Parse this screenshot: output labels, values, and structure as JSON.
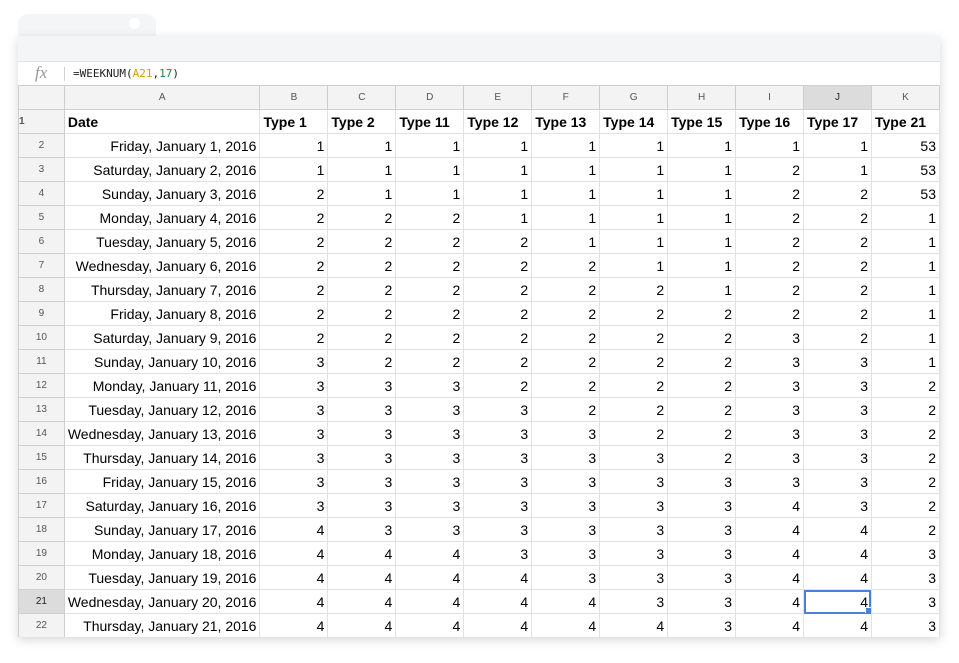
{
  "formula_bar": {
    "fx_label": "fx",
    "tokens": [
      {
        "t": "=WEEKNUM(",
        "c": "fn"
      },
      {
        "t": "A21",
        "c": "ref"
      },
      {
        "t": ",",
        "c": "fn"
      },
      {
        "t": "17",
        "c": "num"
      },
      {
        "t": ")",
        "c": "fn"
      }
    ]
  },
  "columns": [
    "A",
    "B",
    "C",
    "D",
    "E",
    "F",
    "G",
    "H",
    "I",
    "J",
    "K"
  ],
  "selected_column": "J",
  "selected_row": "21",
  "active_cell": {
    "row": 21,
    "col": "J"
  },
  "header_row": {
    "row_number": "1",
    "cells": [
      "Date",
      "Type 1",
      "Type 2",
      "Type 11",
      "Type 12",
      "Type 13",
      "Type 14",
      "Type 15",
      "Type 16",
      "Type 17",
      "Type 21"
    ]
  },
  "rows": [
    {
      "row_number": "2",
      "date": "Friday, January 1, 2016",
      "values": [
        "1",
        "1",
        "1",
        "1",
        "1",
        "1",
        "1",
        "1",
        "1",
        "53"
      ]
    },
    {
      "row_number": "3",
      "date": "Saturday, January 2, 2016",
      "values": [
        "1",
        "1",
        "1",
        "1",
        "1",
        "1",
        "1",
        "2",
        "1",
        "53"
      ]
    },
    {
      "row_number": "4",
      "date": "Sunday, January 3, 2016",
      "values": [
        "2",
        "1",
        "1",
        "1",
        "1",
        "1",
        "1",
        "2",
        "2",
        "53"
      ]
    },
    {
      "row_number": "5",
      "date": "Monday, January 4, 2016",
      "values": [
        "2",
        "2",
        "2",
        "1",
        "1",
        "1",
        "1",
        "2",
        "2",
        "1"
      ]
    },
    {
      "row_number": "6",
      "date": "Tuesday, January 5, 2016",
      "values": [
        "2",
        "2",
        "2",
        "2",
        "1",
        "1",
        "1",
        "2",
        "2",
        "1"
      ]
    },
    {
      "row_number": "7",
      "date": "Wednesday, January 6, 2016",
      "values": [
        "2",
        "2",
        "2",
        "2",
        "2",
        "1",
        "1",
        "2",
        "2",
        "1"
      ]
    },
    {
      "row_number": "8",
      "date": "Thursday, January 7, 2016",
      "values": [
        "2",
        "2",
        "2",
        "2",
        "2",
        "2",
        "1",
        "2",
        "2",
        "1"
      ]
    },
    {
      "row_number": "9",
      "date": "Friday, January 8, 2016",
      "values": [
        "2",
        "2",
        "2",
        "2",
        "2",
        "2",
        "2",
        "2",
        "2",
        "1"
      ]
    },
    {
      "row_number": "10",
      "date": "Saturday, January 9, 2016",
      "values": [
        "2",
        "2",
        "2",
        "2",
        "2",
        "2",
        "2",
        "3",
        "2",
        "1"
      ]
    },
    {
      "row_number": "11",
      "date": "Sunday, January 10, 2016",
      "values": [
        "3",
        "2",
        "2",
        "2",
        "2",
        "2",
        "2",
        "3",
        "3",
        "1"
      ]
    },
    {
      "row_number": "12",
      "date": "Monday, January 11, 2016",
      "values": [
        "3",
        "3",
        "3",
        "2",
        "2",
        "2",
        "2",
        "3",
        "3",
        "2"
      ]
    },
    {
      "row_number": "13",
      "date": "Tuesday, January 12, 2016",
      "values": [
        "3",
        "3",
        "3",
        "3",
        "2",
        "2",
        "2",
        "3",
        "3",
        "2"
      ]
    },
    {
      "row_number": "14",
      "date": "Wednesday, January 13, 2016",
      "values": [
        "3",
        "3",
        "3",
        "3",
        "3",
        "2",
        "2",
        "3",
        "3",
        "2"
      ]
    },
    {
      "row_number": "15",
      "date": "Thursday, January 14, 2016",
      "values": [
        "3",
        "3",
        "3",
        "3",
        "3",
        "3",
        "2",
        "3",
        "3",
        "2"
      ]
    },
    {
      "row_number": "16",
      "date": "Friday, January 15, 2016",
      "values": [
        "3",
        "3",
        "3",
        "3",
        "3",
        "3",
        "3",
        "3",
        "3",
        "2"
      ]
    },
    {
      "row_number": "17",
      "date": "Saturday, January 16, 2016",
      "values": [
        "3",
        "3",
        "3",
        "3",
        "3",
        "3",
        "3",
        "4",
        "3",
        "2"
      ]
    },
    {
      "row_number": "18",
      "date": "Sunday, January 17, 2016",
      "values": [
        "4",
        "3",
        "3",
        "3",
        "3",
        "3",
        "3",
        "4",
        "4",
        "2"
      ]
    },
    {
      "row_number": "19",
      "date": "Monday, January 18, 2016",
      "values": [
        "4",
        "4",
        "4",
        "3",
        "3",
        "3",
        "3",
        "4",
        "4",
        "3"
      ]
    },
    {
      "row_number": "20",
      "date": "Tuesday, January 19, 2016",
      "values": [
        "4",
        "4",
        "4",
        "4",
        "3",
        "3",
        "3",
        "4",
        "4",
        "3"
      ]
    },
    {
      "row_number": "21",
      "date": "Wednesday, January 20, 2016",
      "values": [
        "4",
        "4",
        "4",
        "4",
        "4",
        "3",
        "3",
        "4",
        "4",
        "3"
      ]
    },
    {
      "row_number": "22",
      "date": "Thursday, January 21, 2016",
      "values": [
        "4",
        "4",
        "4",
        "4",
        "4",
        "4",
        "3",
        "4",
        "4",
        "3"
      ]
    }
  ],
  "colors": {
    "selection": "#4a7fdc",
    "header_bg": "#f3f3f3",
    "ref_token": "#d4a017",
    "num_token": "#1e8e3e"
  }
}
